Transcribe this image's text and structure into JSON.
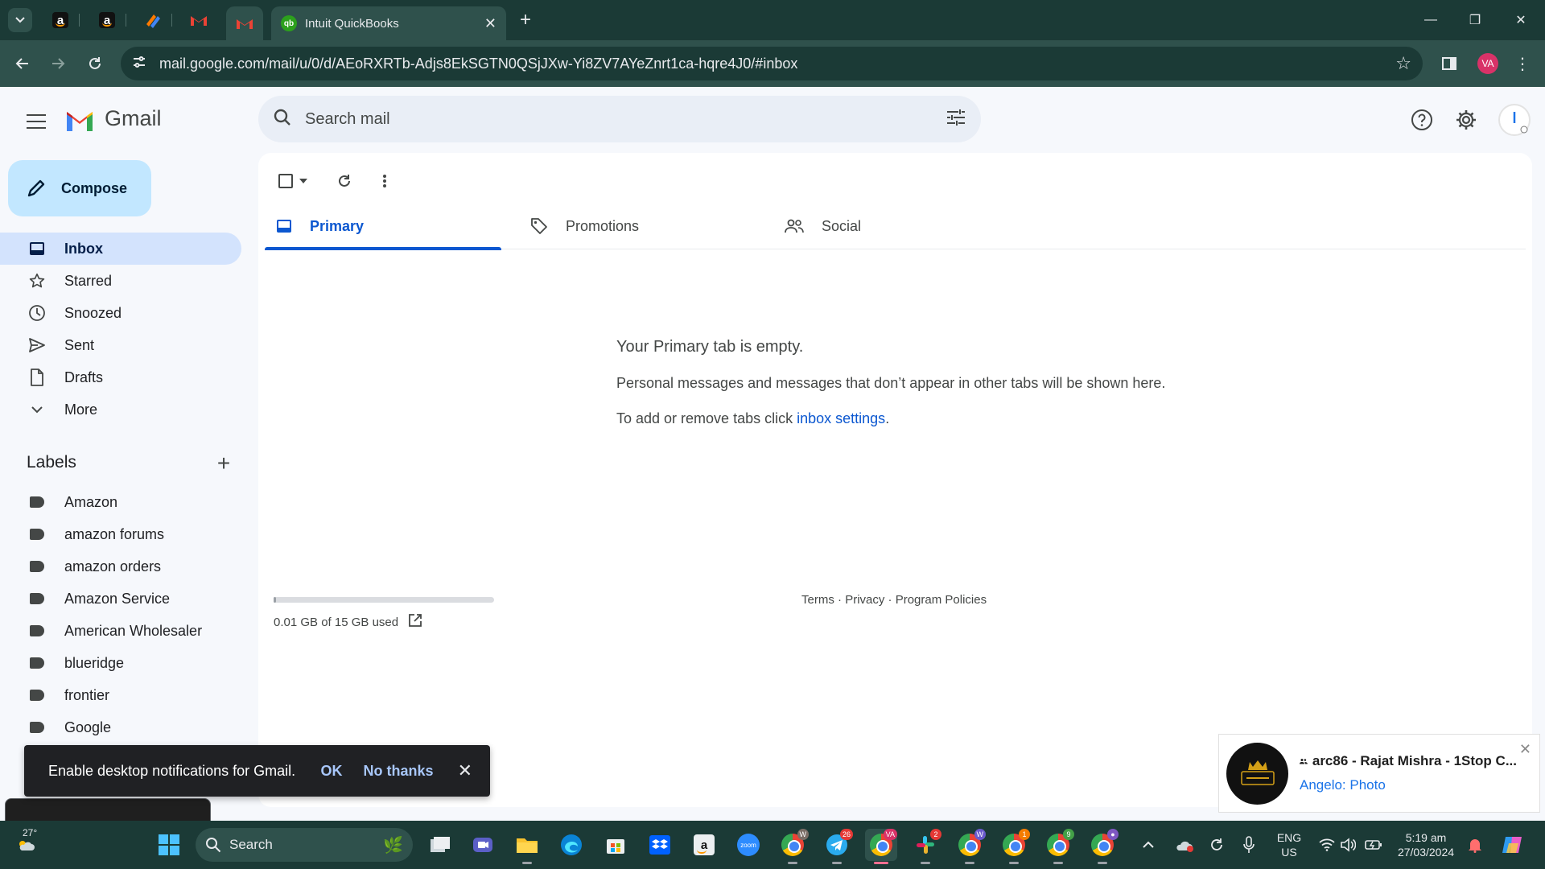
{
  "browser": {
    "active_tab_title": "Intuit QuickBooks",
    "url": "mail.google.com/mail/u/0/d/AEoRXRTb-Adjs8EkSGTN0QSjJXw-Yi8ZV7AYeZnrt1ca-hqre4J0/#inbox",
    "profile_initials": "VA"
  },
  "gmail": {
    "logo_text": "Gmail",
    "search_placeholder": "Search mail",
    "compose_label": "Compose",
    "nav": [
      {
        "label": "Inbox",
        "icon": "inbox-icon"
      },
      {
        "label": "Starred",
        "icon": "star-icon"
      },
      {
        "label": "Snoozed",
        "icon": "clock-icon"
      },
      {
        "label": "Sent",
        "icon": "send-icon"
      },
      {
        "label": "Drafts",
        "icon": "draft-icon"
      },
      {
        "label": "More",
        "icon": "chevron-down-icon"
      }
    ],
    "labels_heading": "Labels",
    "labels": [
      "Amazon",
      "amazon forums",
      "amazon orders",
      "Amazon Service",
      "American Wholesaler",
      "blueridge",
      "frontier",
      "Google"
    ],
    "tabs": [
      {
        "label": "Primary"
      },
      {
        "label": "Promotions"
      },
      {
        "label": "Social"
      }
    ],
    "empty_title": "Your Primary tab is empty.",
    "empty_body": "Personal messages and messages that don’t appear in other tabs will be shown here.",
    "empty_settings_prefix": "To add or remove tabs click ",
    "empty_settings_link": "inbox settings",
    "empty_settings_suffix": ".",
    "storage_text": "0.01 GB of 15 GB used",
    "storage_fraction": 0.001,
    "footer": {
      "terms": "Terms",
      "privacy": "Privacy",
      "policies": "Program Policies",
      "separator": " · "
    }
  },
  "snackbar": {
    "message": "Enable desktop notifications for Gmail.",
    "ok_label": "OK",
    "no_thanks_label": "No thanks"
  },
  "toast": {
    "title": "arc86 - Rajat Mishra - 1Stop C...",
    "subtitle": "Angelo: Photo"
  },
  "taskbar": {
    "weather": "27°",
    "search_label": "Search",
    "badges": {
      "telegram": "26",
      "chrome_va": "VA",
      "slack": "2",
      "chrome_w1": "W",
      "chrome_w2": "W",
      "chrome_1": "1",
      "chrome_9": "9"
    },
    "lang_top": "ENG",
    "lang_bottom": "US",
    "time": "5:19 am",
    "date": "27/03/2024"
  },
  "colors": {
    "accent": "#0b57d0",
    "compose_bg": "#c2e7ff",
    "active_nav_bg": "#d3e3fd",
    "chrome_frame": "#1b3a36"
  }
}
